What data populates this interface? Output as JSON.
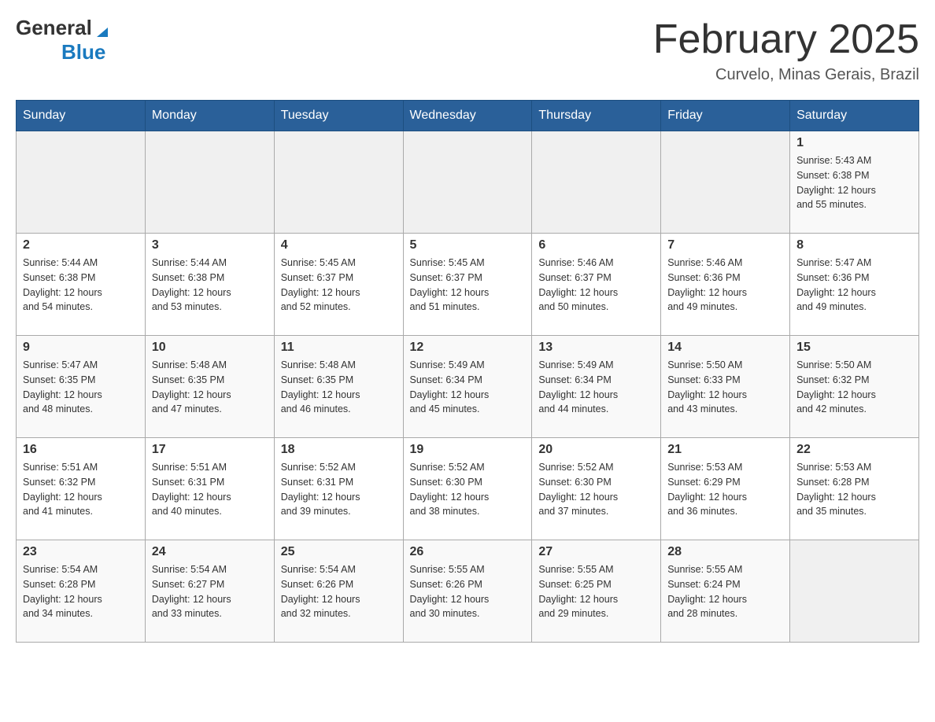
{
  "header": {
    "logo": {
      "text_general": "General",
      "text_blue": "Blue",
      "tagline": ""
    },
    "title": "February 2025",
    "location": "Curvelo, Minas Gerais, Brazil"
  },
  "weekdays": [
    "Sunday",
    "Monday",
    "Tuesday",
    "Wednesday",
    "Thursday",
    "Friday",
    "Saturday"
  ],
  "weeks": [
    [
      {
        "day": "",
        "info": ""
      },
      {
        "day": "",
        "info": ""
      },
      {
        "day": "",
        "info": ""
      },
      {
        "day": "",
        "info": ""
      },
      {
        "day": "",
        "info": ""
      },
      {
        "day": "",
        "info": ""
      },
      {
        "day": "1",
        "info": "Sunrise: 5:43 AM\nSunset: 6:38 PM\nDaylight: 12 hours\nand 55 minutes."
      }
    ],
    [
      {
        "day": "2",
        "info": "Sunrise: 5:44 AM\nSunset: 6:38 PM\nDaylight: 12 hours\nand 54 minutes."
      },
      {
        "day": "3",
        "info": "Sunrise: 5:44 AM\nSunset: 6:38 PM\nDaylight: 12 hours\nand 53 minutes."
      },
      {
        "day": "4",
        "info": "Sunrise: 5:45 AM\nSunset: 6:37 PM\nDaylight: 12 hours\nand 52 minutes."
      },
      {
        "day": "5",
        "info": "Sunrise: 5:45 AM\nSunset: 6:37 PM\nDaylight: 12 hours\nand 51 minutes."
      },
      {
        "day": "6",
        "info": "Sunrise: 5:46 AM\nSunset: 6:37 PM\nDaylight: 12 hours\nand 50 minutes."
      },
      {
        "day": "7",
        "info": "Sunrise: 5:46 AM\nSunset: 6:36 PM\nDaylight: 12 hours\nand 49 minutes."
      },
      {
        "day": "8",
        "info": "Sunrise: 5:47 AM\nSunset: 6:36 PM\nDaylight: 12 hours\nand 49 minutes."
      }
    ],
    [
      {
        "day": "9",
        "info": "Sunrise: 5:47 AM\nSunset: 6:35 PM\nDaylight: 12 hours\nand 48 minutes."
      },
      {
        "day": "10",
        "info": "Sunrise: 5:48 AM\nSunset: 6:35 PM\nDaylight: 12 hours\nand 47 minutes."
      },
      {
        "day": "11",
        "info": "Sunrise: 5:48 AM\nSunset: 6:35 PM\nDaylight: 12 hours\nand 46 minutes."
      },
      {
        "day": "12",
        "info": "Sunrise: 5:49 AM\nSunset: 6:34 PM\nDaylight: 12 hours\nand 45 minutes."
      },
      {
        "day": "13",
        "info": "Sunrise: 5:49 AM\nSunset: 6:34 PM\nDaylight: 12 hours\nand 44 minutes."
      },
      {
        "day": "14",
        "info": "Sunrise: 5:50 AM\nSunset: 6:33 PM\nDaylight: 12 hours\nand 43 minutes."
      },
      {
        "day": "15",
        "info": "Sunrise: 5:50 AM\nSunset: 6:32 PM\nDaylight: 12 hours\nand 42 minutes."
      }
    ],
    [
      {
        "day": "16",
        "info": "Sunrise: 5:51 AM\nSunset: 6:32 PM\nDaylight: 12 hours\nand 41 minutes."
      },
      {
        "day": "17",
        "info": "Sunrise: 5:51 AM\nSunset: 6:31 PM\nDaylight: 12 hours\nand 40 minutes."
      },
      {
        "day": "18",
        "info": "Sunrise: 5:52 AM\nSunset: 6:31 PM\nDaylight: 12 hours\nand 39 minutes."
      },
      {
        "day": "19",
        "info": "Sunrise: 5:52 AM\nSunset: 6:30 PM\nDaylight: 12 hours\nand 38 minutes."
      },
      {
        "day": "20",
        "info": "Sunrise: 5:52 AM\nSunset: 6:30 PM\nDaylight: 12 hours\nand 37 minutes."
      },
      {
        "day": "21",
        "info": "Sunrise: 5:53 AM\nSunset: 6:29 PM\nDaylight: 12 hours\nand 36 minutes."
      },
      {
        "day": "22",
        "info": "Sunrise: 5:53 AM\nSunset: 6:28 PM\nDaylight: 12 hours\nand 35 minutes."
      }
    ],
    [
      {
        "day": "23",
        "info": "Sunrise: 5:54 AM\nSunset: 6:28 PM\nDaylight: 12 hours\nand 34 minutes."
      },
      {
        "day": "24",
        "info": "Sunrise: 5:54 AM\nSunset: 6:27 PM\nDaylight: 12 hours\nand 33 minutes."
      },
      {
        "day": "25",
        "info": "Sunrise: 5:54 AM\nSunset: 6:26 PM\nDaylight: 12 hours\nand 32 minutes."
      },
      {
        "day": "26",
        "info": "Sunrise: 5:55 AM\nSunset: 6:26 PM\nDaylight: 12 hours\nand 30 minutes."
      },
      {
        "day": "27",
        "info": "Sunrise: 5:55 AM\nSunset: 6:25 PM\nDaylight: 12 hours\nand 29 minutes."
      },
      {
        "day": "28",
        "info": "Sunrise: 5:55 AM\nSunset: 6:24 PM\nDaylight: 12 hours\nand 28 minutes."
      },
      {
        "day": "",
        "info": ""
      }
    ]
  ]
}
